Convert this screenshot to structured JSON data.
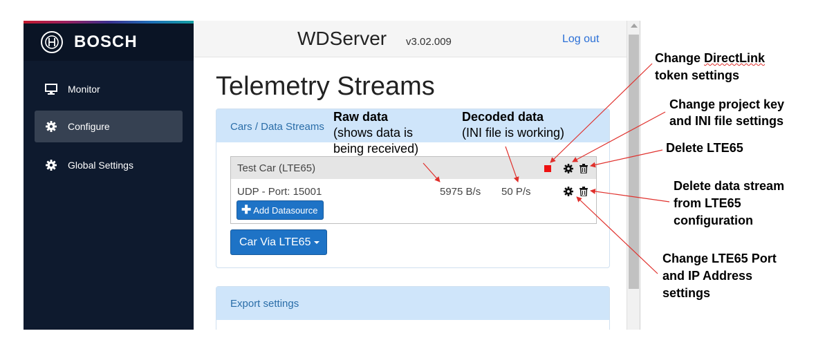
{
  "sidebar": {
    "brand": "BOSCH",
    "items": [
      {
        "label": "Monitor",
        "icon": "monitor-icon"
      },
      {
        "label": "Configure",
        "icon": "gear-icon",
        "active": true
      },
      {
        "label": "Global Settings",
        "icon": "gear-icon"
      }
    ]
  },
  "header": {
    "title": "WDServer",
    "version": "v3.02.009",
    "logout": "Log out"
  },
  "main": {
    "page_title": "Telemetry Streams",
    "panel": {
      "heading": "Cars / Data Streams",
      "car": {
        "name": "Test Car (LTE65)",
        "stream": "UDP - Port: 15001",
        "raw_rate": "5975 B/s",
        "decoded_rate": "50 P/s",
        "add_button": "Add Datasource"
      },
      "car_via_button": "Car Via LTE65"
    },
    "export_panel": {
      "heading": "Export settings"
    }
  },
  "annotations": {
    "raw_title": "Raw data",
    "raw_sub1": "(shows data is",
    "raw_sub2": "being received)",
    "decoded_title": "Decoded data",
    "decoded_sub": "(INI file is working)",
    "directlink_1a": "Change ",
    "directlink_1b": "DirectLink",
    "directlink_2": "token settings",
    "project_1": "Change project key",
    "project_2": "and INI file settings",
    "delete_lte": "Delete LTE65",
    "delete_stream_1": "Delete data stream",
    "delete_stream_2": "from LTE65",
    "delete_stream_3": "configuration",
    "port_1": "Change LTE65 Port",
    "port_2": "and IP Address",
    "port_3": "settings"
  },
  "colors": {
    "sidebar": "#0e1a2e",
    "accent_blue": "#1e73c6",
    "panel_header": "#cfe5fa",
    "stop_red": "#ee1111",
    "arrow_red": "#e0302c"
  }
}
